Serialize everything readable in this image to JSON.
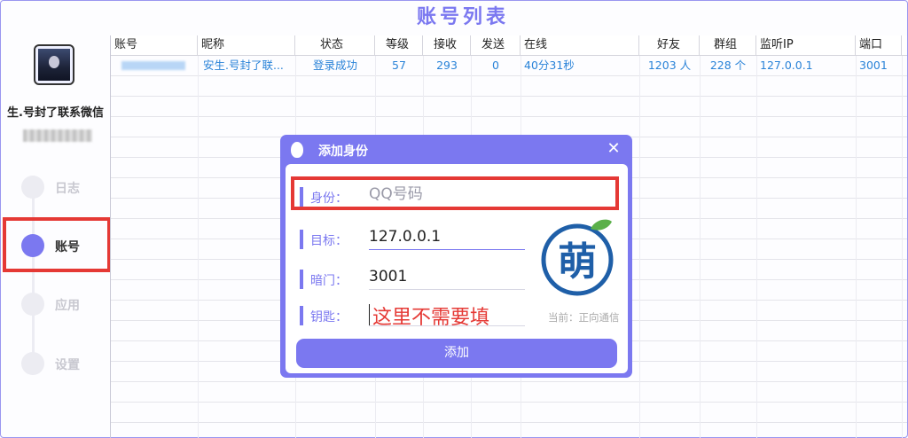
{
  "page_title": "账号列表",
  "sidebar": {
    "nickname": "生.号封了联系微信",
    "nav": [
      {
        "label": "日志"
      },
      {
        "label": "账号"
      },
      {
        "label": "应用"
      },
      {
        "label": "设置"
      }
    ],
    "active_index": 1
  },
  "table": {
    "columns": [
      "账号",
      "昵称",
      "状态",
      "等级",
      "接收",
      "发送",
      "在线",
      "好友",
      "群组",
      "监听IP",
      "端口"
    ],
    "rows": [
      {
        "nickname": "安生.号封了联...",
        "status": "登录成功",
        "level": "57",
        "received": "293",
        "sent": "0",
        "online": "40分31秒",
        "friends": "1203 人",
        "groups": "228 个",
        "listen_ip": "127.0.0.1",
        "port": "3001"
      }
    ]
  },
  "dialog": {
    "title": "添加身份",
    "close_glyph": "✕",
    "fields": {
      "identity": {
        "label": "身份：",
        "placeholder": "QQ号码",
        "value": ""
      },
      "target": {
        "label": "目标：",
        "value": "127.0.0.1"
      },
      "backdoor": {
        "label": "暗门：",
        "value": "3001"
      },
      "key": {
        "label": "钥匙：",
        "value": ""
      }
    },
    "key_hint": "这里不需要填",
    "logo_char": "萌",
    "current_label": "当前：正向通信",
    "submit_label": "添加"
  },
  "colors": {
    "accent": "#7b78f0",
    "link": "#2a83d8",
    "annotation": "#e53935"
  }
}
